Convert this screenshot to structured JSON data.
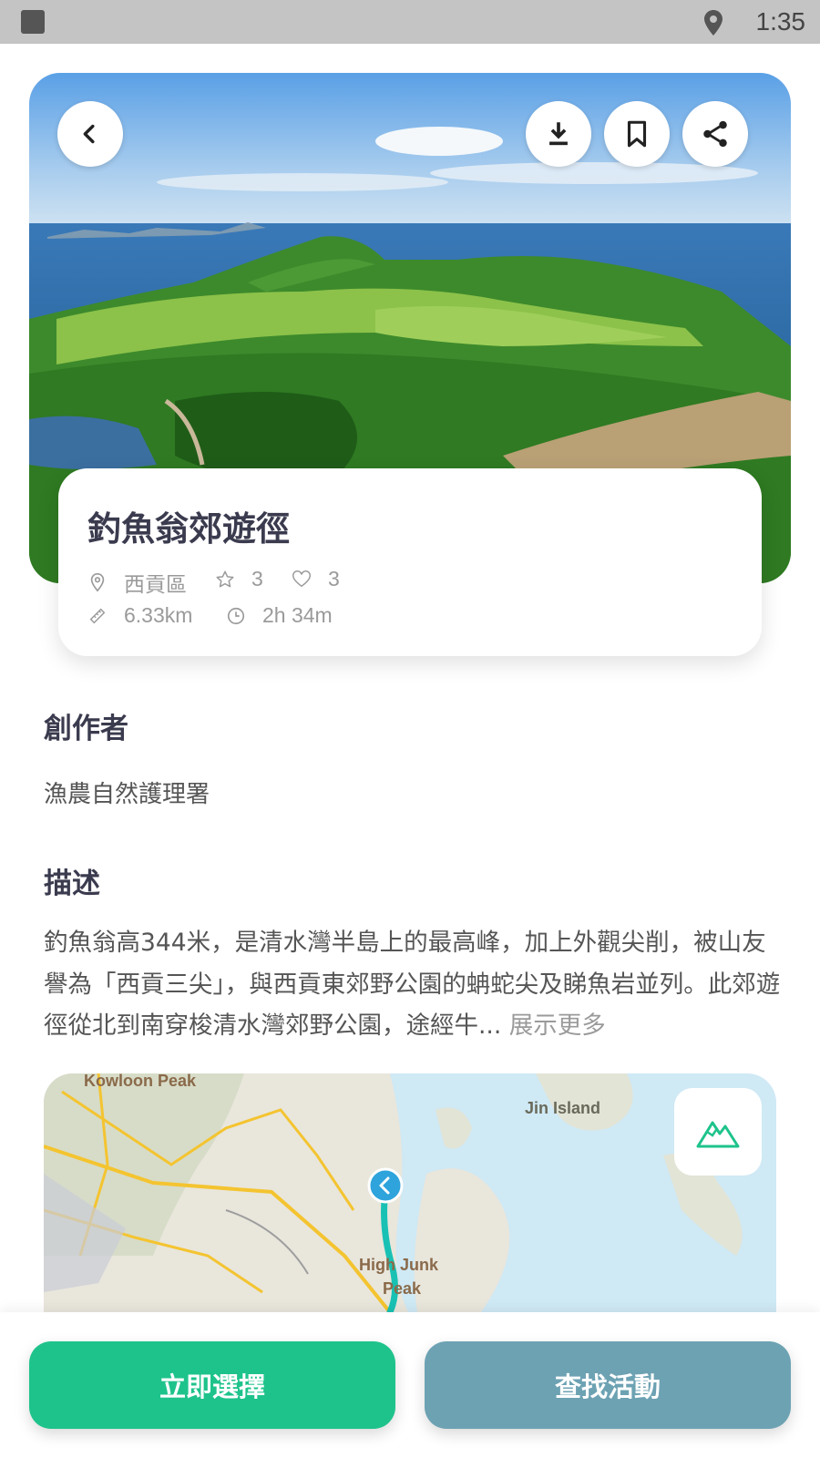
{
  "status_bar": {
    "time": "1:35"
  },
  "trail": {
    "title": "釣魚翁郊遊徑",
    "district": "西貢區",
    "rating": "3",
    "likes": "3",
    "distance": "6.33km",
    "duration": "2h 34m"
  },
  "creator": {
    "heading": "創作者",
    "name": "漁農自然護理署"
  },
  "description": {
    "heading": "描述",
    "text": "釣魚翁高344米，是清水灣半島上的最高峰，加上外觀尖削，被山友譽為「西貢三尖」，與西貢東郊野公園的蚺蛇尖及睇魚岩並列。此郊遊徑從北到南穿梭清水灣郊野公園，途經牛...",
    "more_label": "展示更多"
  },
  "map": {
    "labels": {
      "kowloon_peak": "Kowloon Peak",
      "jin_island": "Jin Island",
      "high_junk_peak_1": "High Junk",
      "high_junk_peak_2": "Peak"
    }
  },
  "actions": {
    "select_label": "立即選擇",
    "find_label": "查找活動"
  },
  "colors": {
    "accent_green": "#1ec38b",
    "slate_blue": "#6da2b3",
    "route": "#19c1b4"
  },
  "icons": [
    "back-arrow-icon",
    "download-icon",
    "bookmark-icon",
    "share-icon",
    "location-pin-icon",
    "star-icon",
    "heart-icon",
    "ruler-icon",
    "clock-icon",
    "mountain-icon"
  ]
}
